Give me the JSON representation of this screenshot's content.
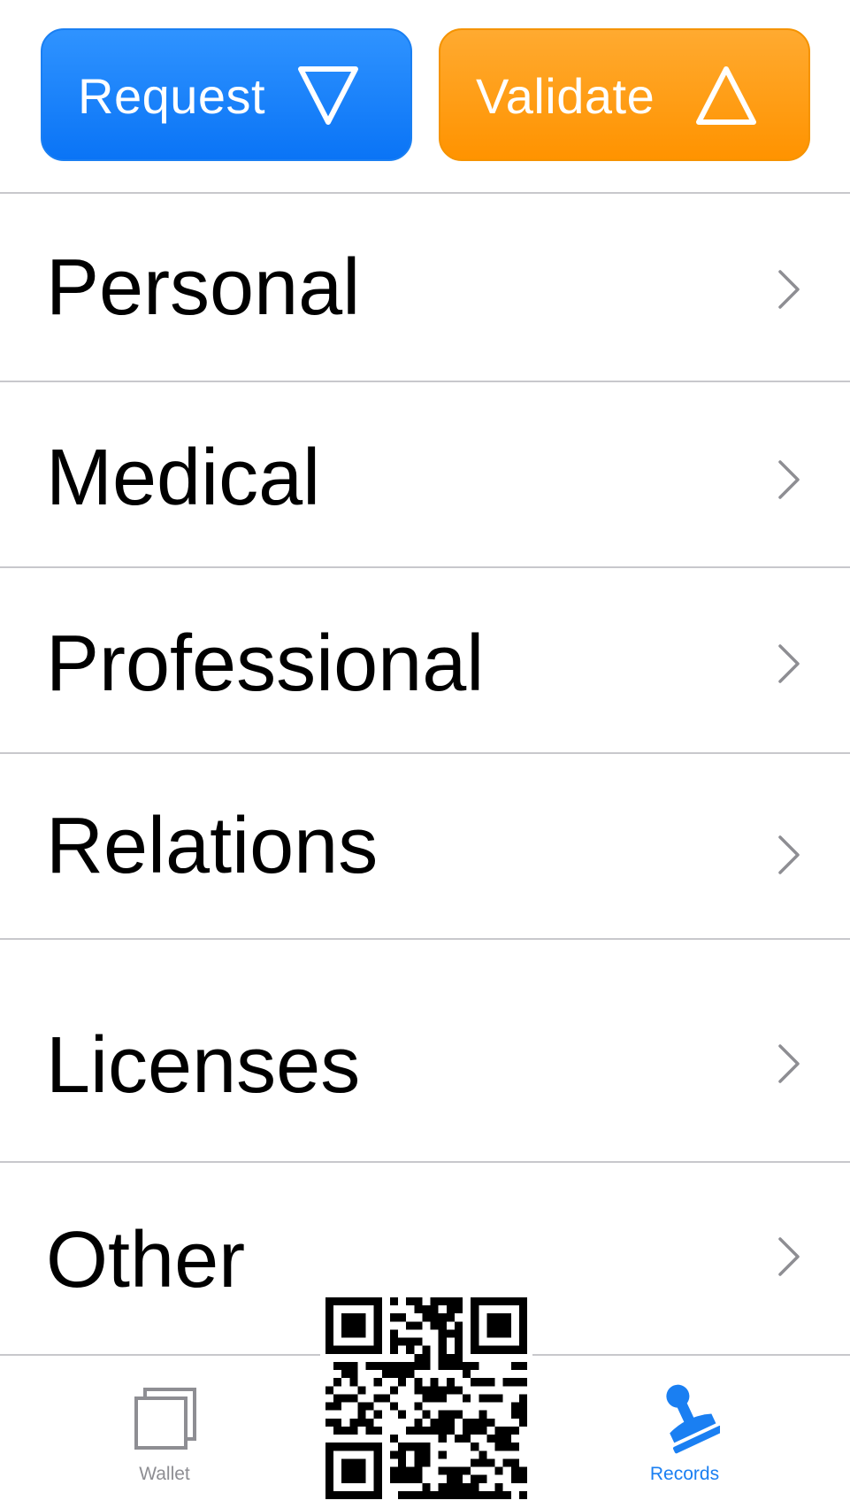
{
  "actions": {
    "request_label": "Request",
    "validate_label": "Validate",
    "request_color": "#0a74f6",
    "validate_color": "#ff9300"
  },
  "records": {
    "items": [
      {
        "label": "Personal"
      },
      {
        "label": "Medical"
      },
      {
        "label": "Professional"
      },
      {
        "label": "Relations"
      },
      {
        "label": "Licenses"
      },
      {
        "label": "Other"
      }
    ]
  },
  "tabbar": {
    "wallet_label": "Wallet",
    "records_label": "Records",
    "selected": "Records",
    "inactive_color": "#8e8e93",
    "active_color": "#1a7ff2"
  },
  "icons": {
    "request": "triangle-down-icon",
    "validate": "triangle-up-icon",
    "row_disclosure": "chevron-right-icon",
    "wallet": "stacked-cards-icon",
    "records": "stamp-icon",
    "center": "qr-code-icon"
  }
}
